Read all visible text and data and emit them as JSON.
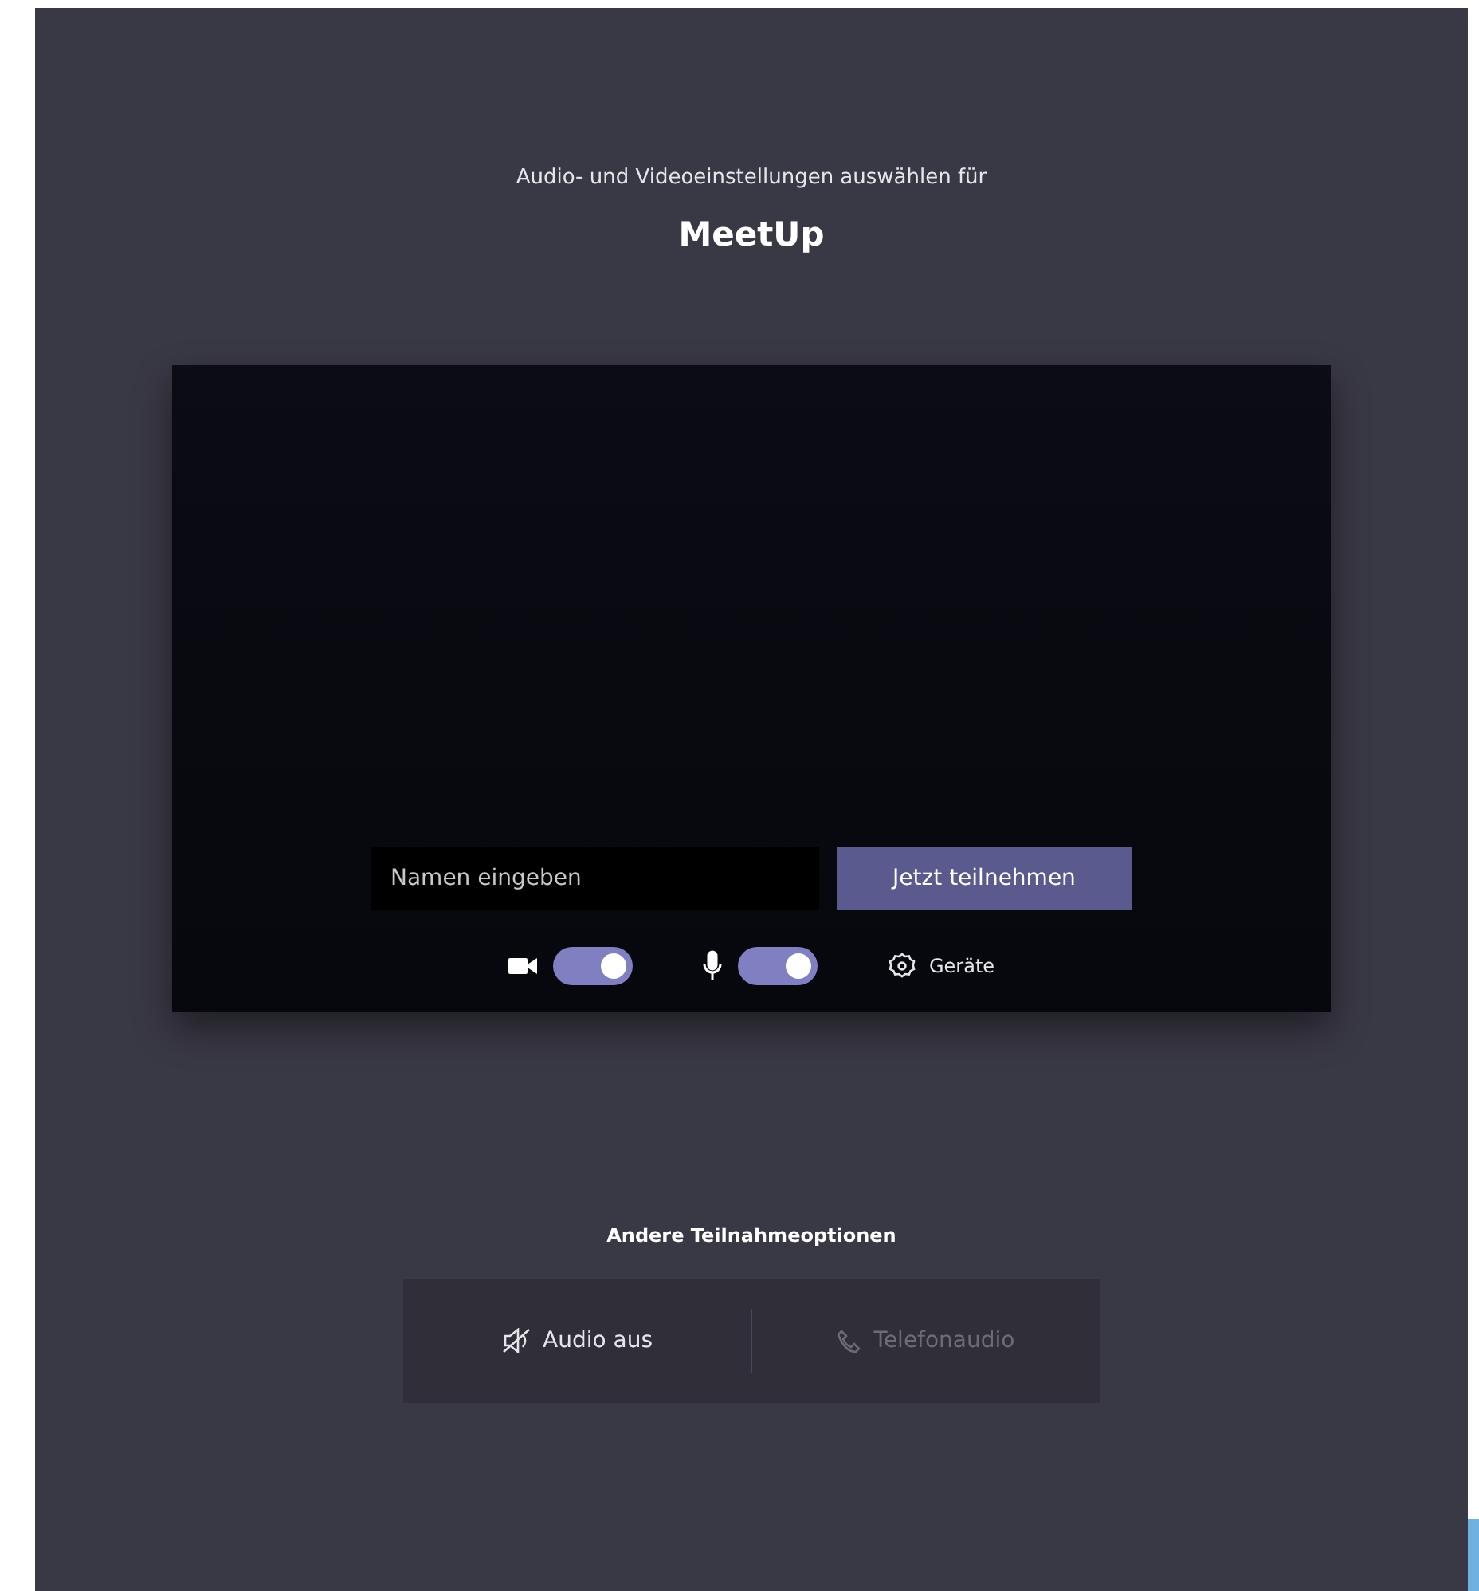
{
  "subtitle": "Audio- und Videoeinstellungen auswählen für",
  "meeting_title": "MeetUp",
  "name_field": {
    "placeholder": "Namen eingeben"
  },
  "join_button": "Jetzt teilnehmen",
  "toggles": [
    {
      "kind": "camera",
      "on": true
    },
    {
      "kind": "microphone",
      "on": true
    }
  ],
  "devices_button": "Geräte",
  "other_options": {
    "heading": "Andere Teilnahmeoptionen",
    "options": [
      {
        "kind": "audio-off",
        "label": "Audio aus",
        "disabled": false
      },
      {
        "kind": "phone",
        "label": "Telefonaudio",
        "disabled": true
      }
    ]
  }
}
